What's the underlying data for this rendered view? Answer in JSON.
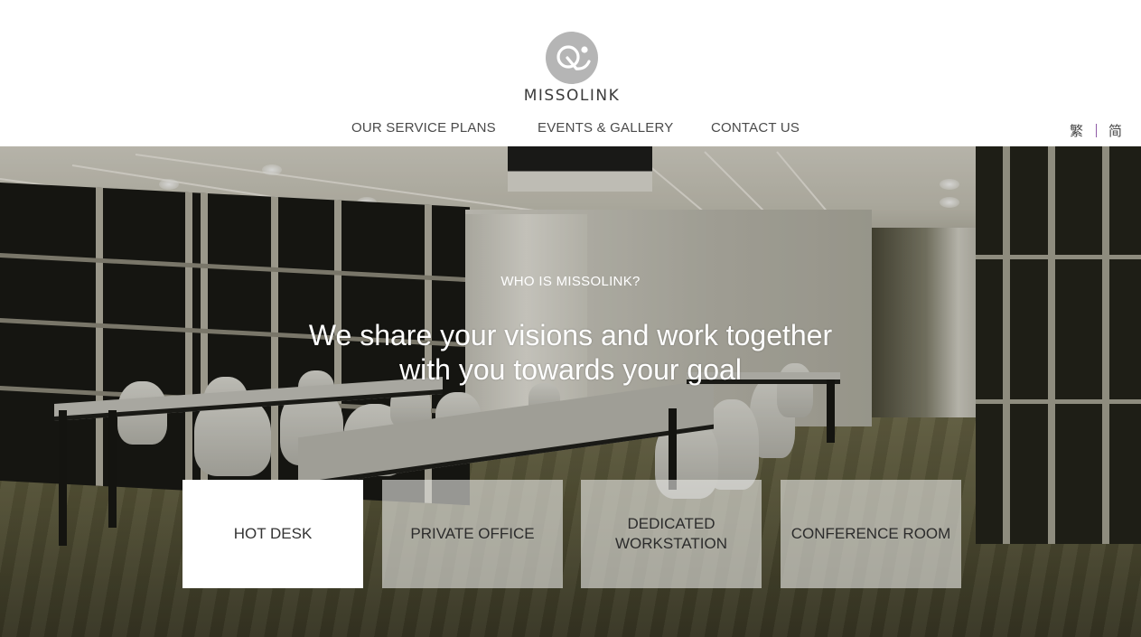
{
  "brand": {
    "logo_text": "MISSOLINK",
    "logo_icon": "missolink-q-smile-logo",
    "logo_color": "#b5b5b5"
  },
  "nav": {
    "items": [
      {
        "label": "OUR SERVICE PLANS"
      },
      {
        "label": "EVENTS & GALLERY"
      },
      {
        "label": "CONTACT US"
      }
    ]
  },
  "language": {
    "traditional": "繁",
    "simplified": "简",
    "separator_color": "#8e5aa6"
  },
  "hero": {
    "kicker": "WHO IS MISSOLINK?",
    "headline_line1": "We share your visions and work together",
    "headline_line2": "with you towards your goal",
    "background": "coworking-office-photo"
  },
  "plans": [
    {
      "label": "HOT DESK",
      "active": true
    },
    {
      "label": "PRIVATE OFFICE",
      "active": false
    },
    {
      "label_line1": "DEDICATED",
      "label_line2": "WORKSTATION",
      "active": false
    },
    {
      "label": "CONFERENCE ROOM",
      "active": false
    }
  ]
}
